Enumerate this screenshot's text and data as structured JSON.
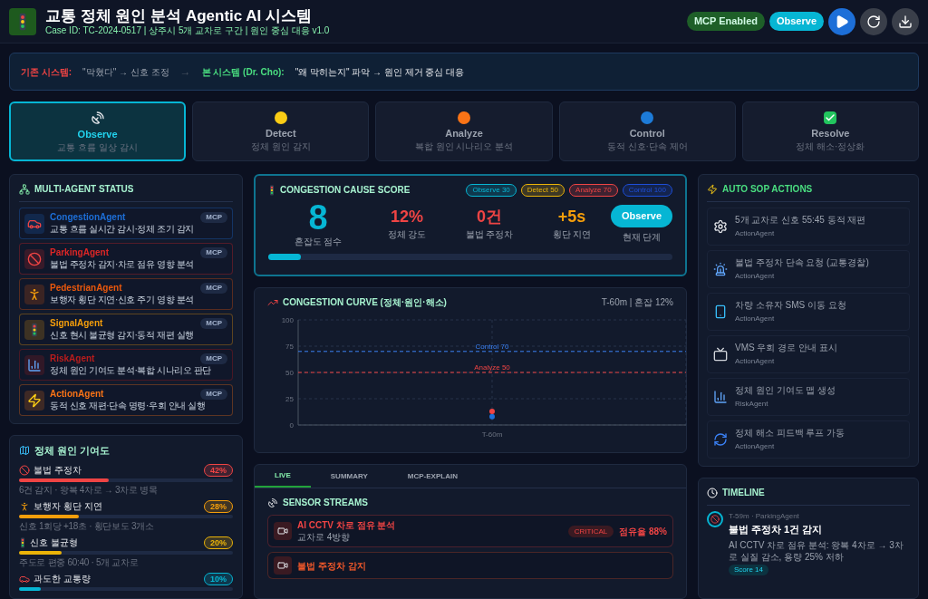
{
  "header": {
    "title": "교통 정체 원인 분석 Agentic AI 시스템",
    "subtitle": "Case ID: TC-2024-0517 | 상주시 5개 교차로 구간 | 원인 중심 대응 v1.0",
    "mcp_badge": "MCP Enabled",
    "phase_badge": "Observe"
  },
  "banner": {
    "legacy_label": "기존 시스템:",
    "legacy_text": "\"막혔다\" → 신호 조정",
    "arrow": "→",
    "new_label": "본 시스템 (Dr. Cho):",
    "new_text": "\"왜 막히는지\" 파악 → 원인 제거 중심 대응"
  },
  "phases": [
    {
      "kind": "dish",
      "label": "Observe",
      "desc": "교통 흐름 일상 감시",
      "selected": true
    },
    {
      "kind": "dot",
      "color": "#facc15",
      "label": "Detect",
      "desc": "정체 원인 감지",
      "selected": false
    },
    {
      "kind": "dot",
      "color": "#f97316",
      "label": "Analyze",
      "desc": "복합 원인 시나리오 분석",
      "selected": false
    },
    {
      "kind": "dot",
      "color": "#1d7bd8",
      "label": "Control",
      "desc": "동적 신호·단속 제어",
      "selected": false
    },
    {
      "kind": "check",
      "label": "Resolve",
      "desc": "정체 해소·정상화",
      "selected": false
    }
  ],
  "agents": {
    "title": "MULTI-AGENT STATUS",
    "items": [
      {
        "name": "CongestionAgent",
        "desc": "교통 흐름 실시간 감시·정체 조기 감지",
        "color": "#1d6fd8",
        "badge": "MCP"
      },
      {
        "name": "ParkingAgent",
        "desc": "불법 주정차 감지·차로 점유 영향 분석",
        "color": "#dc2626",
        "badge": "MCP"
      },
      {
        "name": "PedestrianAgent",
        "desc": "보행자 횡단 지연·신호 주기 영향 분석",
        "color": "#ea580c",
        "badge": "MCP"
      },
      {
        "name": "SignalAgent",
        "desc": "신호 현시 불균형 감지·동적 재편 실행",
        "color": "#f59e0b",
        "badge": "MCP"
      },
      {
        "name": "RiskAgent",
        "desc": "정체 원인 기여도 분석·복합 시나리오 판단",
        "color": "#b91c1c",
        "badge": "MCP"
      },
      {
        "name": "ActionAgent",
        "desc": "동적 신호 재편·단속 명령·우회 안내 실행",
        "color": "#f97316",
        "badge": "MCP"
      }
    ]
  },
  "contributions": {
    "title": "정체 원인 기여도",
    "items": [
      {
        "label": "불법 주정차",
        "pct": "42%",
        "level": 0.42,
        "color": "#ef4444",
        "detail": "6건 감지 · 왕복 4차로 → 3차로 병목"
      },
      {
        "label": "보행자 횡단 지연",
        "pct": "28%",
        "level": 0.28,
        "color": "#f59e0b",
        "detail": "신호 1회당 +18초 · 횡단보도 3개소"
      },
      {
        "label": "신호 불균형",
        "pct": "20%",
        "level": 0.2,
        "color": "#eab308",
        "detail": "주도로 편중 60:40 · 5개 교차로"
      },
      {
        "label": "과도한 교통량",
        "pct": "10%",
        "level": 0.1,
        "color": "#06b6d4"
      }
    ]
  },
  "score": {
    "title": "CONGESTION CAUSE SCORE",
    "chips": [
      {
        "label": "Observe 30",
        "color": "#06b6d4"
      },
      {
        "label": "Detect 50",
        "color": "#eab308"
      },
      {
        "label": "Analyze 70",
        "color": "#ef4444"
      },
      {
        "label": "Control 100",
        "color": "#1d4ed8"
      }
    ],
    "main_value": "8",
    "main_label": "혼잡도 점수",
    "stats": [
      {
        "value": "12%",
        "label": "정체 강도",
        "color": "#ef4444"
      },
      {
        "value": "0건",
        "label": "불법 주정차",
        "color": "#ef4444"
      },
      {
        "value": "+5s",
        "label": "횡단 지연",
        "color": "#f59e0b"
      }
    ],
    "stage_badge": "Observe",
    "stage_label": "현재 단계",
    "level": 0.08
  },
  "curve": {
    "title": "CONGESTION CURVE (정체·원인·해소)",
    "meta": "T-60m | 혼잡 12%",
    "chart_data": {
      "type": "line",
      "categories": [
        "T-60m"
      ],
      "series": [
        {
          "color": "#1d6fd8",
          "values": [
            8
          ],
          "marker": true
        },
        {
          "color": "#ef4444",
          "values": [
            13
          ],
          "marker": true
        }
      ],
      "ylim": [
        0,
        100
      ],
      "yticks": [
        0,
        25,
        50,
        75,
        100
      ],
      "grid": true,
      "ref_lines": [
        {
          "axis": "y",
          "value": 70,
          "label": "Control 70",
          "color": "#3b82f6"
        },
        {
          "axis": "y",
          "value": 50,
          "label": "Analyze 50",
          "color": "#ef4444"
        }
      ]
    }
  },
  "tabs": [
    {
      "label": "LIVE",
      "selected": true
    },
    {
      "label": "SUMMARY",
      "selected": false
    },
    {
      "label": "MCP-EXPLAIN",
      "selected": false
    }
  ],
  "sensors": {
    "title": "SENSOR STREAMS",
    "items": [
      {
        "title": "AI CCTV 차로 점유 분석",
        "location": "교차로 4방향",
        "severity": "CRITICAL",
        "reading": "점유율 88%",
        "color": "#ef4444"
      },
      {
        "title": "불법 주정차 감지",
        "color": "#f0582a"
      }
    ]
  },
  "sop": {
    "title": "AUTO SOP ACTIONS",
    "items": [
      {
        "text": "5개 교차로 신호 55:45 동적 재편",
        "agent": "ActionAgent"
      },
      {
        "text": "불법 주정차 단속 요청 (교통경찰)",
        "agent": "ActionAgent"
      },
      {
        "text": "차량 소유자 SMS 이동 요청",
        "agent": "ActionAgent"
      },
      {
        "text": "VMS 우회 경로 안내 표시",
        "agent": "ActionAgent"
      },
      {
        "text": "정체 원인 기여도 맵 생성",
        "agent": "RiskAgent"
      },
      {
        "text": "정체 해소 피드백 루프 가동",
        "agent": "ActionAgent"
      }
    ]
  },
  "timeline": {
    "title": "TIMELINE",
    "items": [
      {
        "meta": "T-59m · ParkingAgent",
        "title": "불법 주정차 1건 감지",
        "desc": "AI CCTV 차로 점유 분석: 왕복 4차로 → 3차로 실질 감소, 용량 25% 저하",
        "score": "Score 14"
      }
    ]
  }
}
